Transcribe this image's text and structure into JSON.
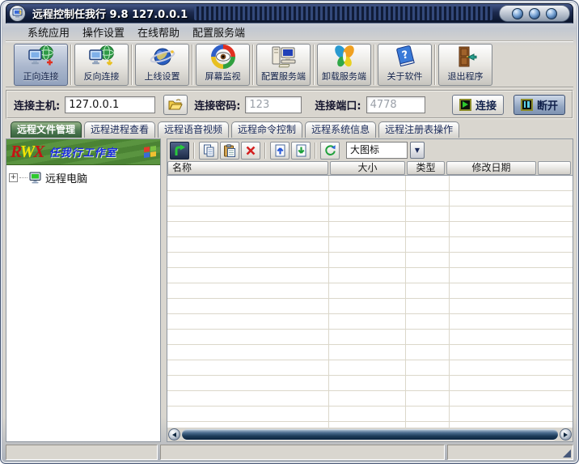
{
  "window": {
    "title": "远程控制任我行 9.8 127.0.0.1",
    "title_buttons": [
      "minimize",
      "maximize",
      "close"
    ]
  },
  "menu": {
    "items": [
      "系统应用",
      "操作设置",
      "在线帮助",
      "配置服务端"
    ]
  },
  "toolbar": {
    "buttons": [
      {
        "label": "正向连接",
        "icon": "computer-globe-plus",
        "pressed": true
      },
      {
        "label": "反向连接",
        "icon": "computer-globe-down",
        "pressed": false
      },
      {
        "label": "上线设置",
        "icon": "globe-ring",
        "pressed": false
      },
      {
        "label": "屏幕监视",
        "icon": "eye-circle",
        "pressed": false
      },
      {
        "label": "配置服务端",
        "icon": "computer-config",
        "pressed": false
      },
      {
        "label": "卸载服务端",
        "icon": "butterfly",
        "pressed": false
      },
      {
        "label": "关于软件",
        "icon": "help-book",
        "pressed": false
      },
      {
        "label": "退出程序",
        "icon": "exit-door",
        "pressed": false
      }
    ]
  },
  "connection": {
    "host_label": "连接主机:",
    "host_value": "127.0.0.1",
    "password_label": "连接密码:",
    "password_value": "123",
    "port_label": "连接端口:",
    "port_value": "4778",
    "connect_label": "连接",
    "disconnect_label": "断开"
  },
  "tabs": [
    {
      "label": "远程文件管理",
      "active": true
    },
    {
      "label": "远程进程查看",
      "active": false
    },
    {
      "label": "远程语音视频",
      "active": false
    },
    {
      "label": "远程命令控制",
      "active": false
    },
    {
      "label": "远程系统信息",
      "active": false
    },
    {
      "label": "远程注册表操作",
      "active": false
    }
  ],
  "sidebar": {
    "logo": {
      "letters": [
        "R",
        "W",
        "X"
      ],
      "studio": "任我行工作室"
    },
    "tree": [
      {
        "expander": "+",
        "label": "远程电脑"
      }
    ]
  },
  "file_panel": {
    "tools": [
      "up-level",
      "copy",
      "paste",
      "delete",
      "upload",
      "download",
      "refresh"
    ],
    "view_mode": "大图标",
    "columns": [
      "名称",
      "大小",
      "类型",
      "修改日期"
    ],
    "rows": []
  },
  "status_bar": {
    "sections": [
      "",
      "",
      ""
    ]
  },
  "colors": {
    "title_navy": "#1c2a4e",
    "frame_silver": "#d9d6cf",
    "active_tab_green": "#4e7a52",
    "banner_green": "#4b8334",
    "scrollbar_steel": "#1d3c5a",
    "pressed_button_blue": "#aab7cd",
    "studio_text_blue": "#1b2ce0",
    "disabled_text": "#9aa0a8"
  }
}
